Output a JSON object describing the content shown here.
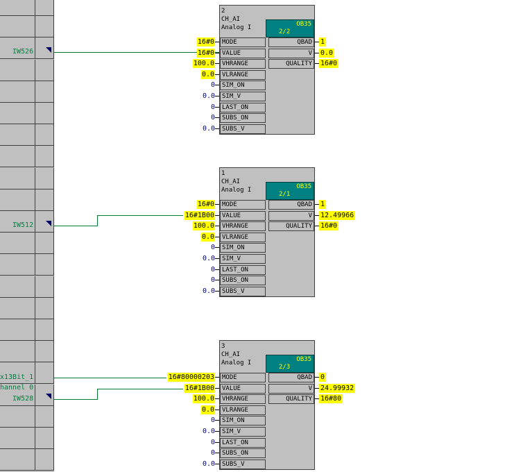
{
  "left_signals": {
    "s1": "IW526",
    "s2": "IW512",
    "s3a": "x13Bit_1",
    "s3b": "hannel 0",
    "s3c": "IW528"
  },
  "blocks": [
    {
      "number": "2",
      "type": "CH_AI",
      "desc": "Analog I",
      "ob": "OB35",
      "runtime": "2/2",
      "inputs": [
        {
          "name": "MODE",
          "value": "16#0"
        },
        {
          "name": "VALUE",
          "value": "16#0"
        },
        {
          "name": "VHRANGE",
          "value": "100.0"
        },
        {
          "name": "VLRANGE",
          "value": "0.0"
        },
        {
          "name": "SIM_ON",
          "value": "0"
        },
        {
          "name": "SIM_V",
          "value": "0.0"
        },
        {
          "name": "LAST_ON",
          "value": "0"
        },
        {
          "name": "SUBS_ON",
          "value": "0"
        },
        {
          "name": "SUBS_V",
          "value": "0.0"
        }
      ],
      "outputs": [
        {
          "name": "QBAD",
          "value": "1"
        },
        {
          "name": "V",
          "value": "0.0"
        },
        {
          "name": "QUALITY",
          "value": "16#0"
        }
      ]
    },
    {
      "number": "1",
      "type": "CH_AI",
      "desc": "Analog I",
      "ob": "OB35",
      "runtime": "2/1",
      "inputs": [
        {
          "name": "MODE",
          "value": "16#0"
        },
        {
          "name": "VALUE",
          "value": "16#1B00"
        },
        {
          "name": "VHRANGE",
          "value": "100.0"
        },
        {
          "name": "VLRANGE",
          "value": "0.0"
        },
        {
          "name": "SIM_ON",
          "value": "0"
        },
        {
          "name": "SIM_V",
          "value": "0.0"
        },
        {
          "name": "LAST_ON",
          "value": "0"
        },
        {
          "name": "SUBS_ON",
          "value": "0"
        },
        {
          "name": "SUBS_V",
          "value": "0.0"
        }
      ],
      "outputs": [
        {
          "name": "QBAD",
          "value": "1"
        },
        {
          "name": "V",
          "value": "12.49966"
        },
        {
          "name": "QUALITY",
          "value": "16#0"
        }
      ]
    },
    {
      "number": "3",
      "type": "CH_AI",
      "desc": "Analog I",
      "ob": "OB35",
      "runtime": "2/3",
      "inputs": [
        {
          "name": "MODE",
          "value": "16#80000203"
        },
        {
          "name": "VALUE",
          "value": "16#1B00"
        },
        {
          "name": "VHRANGE",
          "value": "100.0"
        },
        {
          "name": "VLRANGE",
          "value": "0.0"
        },
        {
          "name": "SIM_ON",
          "value": "0"
        },
        {
          "name": "SIM_V",
          "value": "0.0"
        },
        {
          "name": "LAST_ON",
          "value": "0"
        },
        {
          "name": "SUBS_ON",
          "value": "0"
        },
        {
          "name": "SUBS_V",
          "value": "0.0"
        }
      ],
      "outputs": [
        {
          "name": "QBAD",
          "value": "0"
        },
        {
          "name": "V",
          "value": "24.99932"
        },
        {
          "name": "QUALITY",
          "value": "16#80"
        }
      ]
    }
  ],
  "colors": {
    "wire": "#007a2e",
    "highlight": "#ffff00",
    "ob_box": "#008080",
    "block": "#c0c0c0"
  }
}
